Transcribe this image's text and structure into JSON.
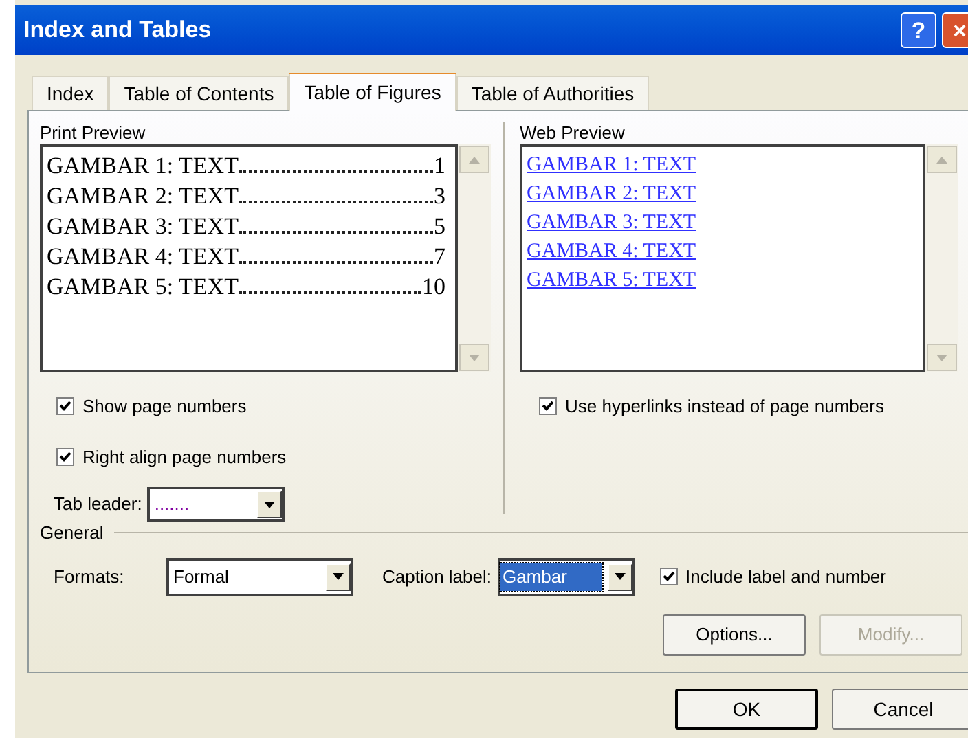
{
  "window": {
    "title": "Index and Tables"
  },
  "title_buttons": [
    "?",
    "×"
  ],
  "tabs": [
    {
      "label": "Index",
      "selected": false
    },
    {
      "label": "Table of Contents",
      "selected": false
    },
    {
      "label": "Table of Figures",
      "selected": true
    },
    {
      "label": "Table of Authorities",
      "selected": false
    }
  ],
  "print_preview": {
    "label": "Print Preview",
    "entries": [
      {
        "text": "GAMBAR 1: TEXT",
        "page": "1"
      },
      {
        "text": "GAMBAR 2: TEXT",
        "page": "3"
      },
      {
        "text": "GAMBAR 3: TEXT",
        "page": "5"
      },
      {
        "text": "GAMBAR 4: TEXT",
        "page": "7"
      },
      {
        "text": "GAMBAR 5: TEXT",
        "page": "10"
      }
    ]
  },
  "web_preview": {
    "label": "Web Preview",
    "entries": [
      "GAMBAR 1: TEXT",
      "GAMBAR 2: TEXT",
      "GAMBAR 3: TEXT",
      "GAMBAR 4: TEXT",
      "GAMBAR 5: TEXT"
    ]
  },
  "left_options": [
    {
      "label": "Show page numbers",
      "checked": true
    },
    {
      "label": "Right align page numbers",
      "checked": true
    }
  ],
  "tab_leader": {
    "label": "Tab leader:",
    "value": "......."
  },
  "hyperlinks_option": {
    "label": "Use hyperlinks instead of page numbers",
    "checked": true
  },
  "general": {
    "label": "General",
    "formats": {
      "label": "Formats:",
      "value": "Formal"
    },
    "caption_label": {
      "label": "Caption label:",
      "value": "Gambar"
    },
    "include_label": {
      "label": "Include label and number",
      "checked": true
    }
  },
  "buttons": [
    {
      "label": "Options...",
      "disabled": false
    },
    {
      "label": "Modify...",
      "disabled": true
    }
  ],
  "footer_buttons": [
    "OK",
    "Cancel"
  ]
}
